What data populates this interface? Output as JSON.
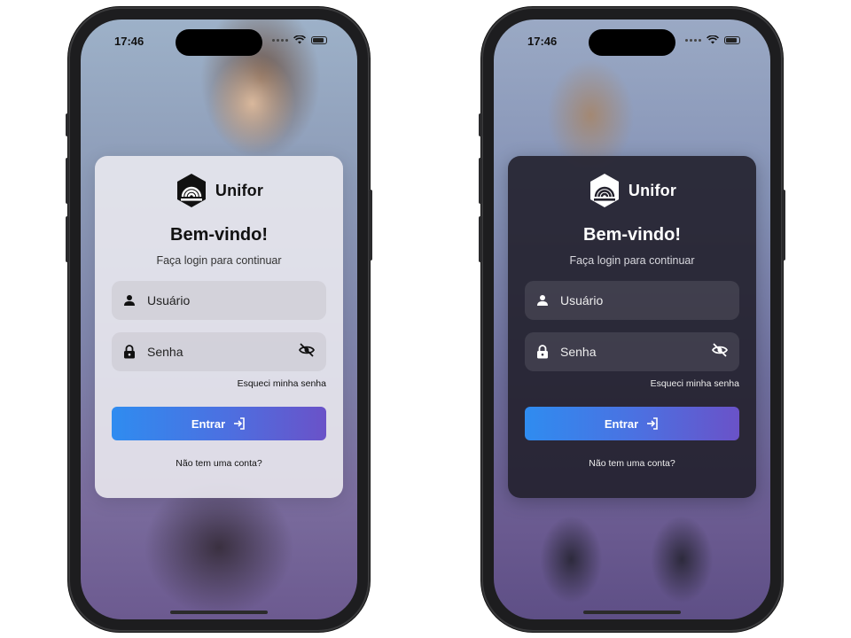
{
  "screens": [
    {
      "theme": "light",
      "status": {
        "time": "17:46"
      },
      "brand": {
        "name": "Unifor"
      },
      "title": "Bem-vindo!",
      "subtitle": "Faça login para continuar",
      "username": {
        "placeholder": "Usuário",
        "icon": "person-icon"
      },
      "password": {
        "placeholder": "Senha",
        "icon": "lock-icon",
        "toggle_icon": "eye-off-icon"
      },
      "forgot_link": "Esqueci minha senha",
      "submit_label": "Entrar",
      "signup_link": "Não tem uma conta?"
    },
    {
      "theme": "dark",
      "status": {
        "time": "17:46"
      },
      "brand": {
        "name": "Unifor"
      },
      "title": "Bem-vindo!",
      "subtitle": "Faça login para continuar",
      "username": {
        "placeholder": "Usuário",
        "icon": "person-icon"
      },
      "password": {
        "placeholder": "Senha",
        "icon": "lock-icon",
        "toggle_icon": "eye-off-icon"
      },
      "forgot_link": "Esqueci minha senha",
      "submit_label": "Entrar",
      "signup_link": "Não tem uma conta?"
    }
  ],
  "colors": {
    "button_gradient_start": "#2f8cf0",
    "button_gradient_end": "#6a52c8",
    "light_card": "#eceaf0",
    "dark_card": "#22202c"
  }
}
